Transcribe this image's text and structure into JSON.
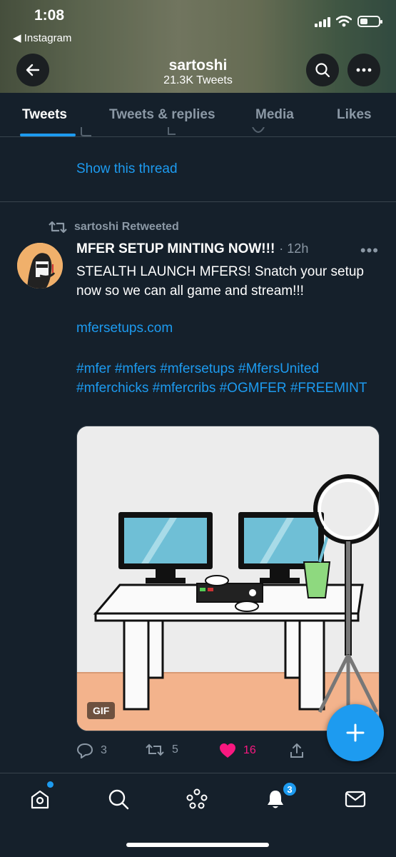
{
  "status": {
    "time": "1:08",
    "back_app": "◀ Instagram"
  },
  "header": {
    "name": "sartoshi",
    "tweet_count": "21.3K Tweets"
  },
  "tabs": [
    {
      "label": "Tweets",
      "active": true
    },
    {
      "label": "Tweets & replies"
    },
    {
      "label": "Media"
    },
    {
      "label": "Likes"
    }
  ],
  "previous_tweet": {
    "show_thread": "Show this thread"
  },
  "tweet": {
    "retweet_label": "sartoshi Retweeted",
    "display_name": "MFER SETUP MINTING NOW!!!",
    "time": "· 12h",
    "more": "•••",
    "text": "STEALTH LAUNCH MFERS! Snatch your setup now so we can all game and stream!!!",
    "link": "mfersetups.com",
    "hashtags": "#mfer #mfers #mfersetups #MfersUnited #mferchicks #mfercribs #OGMFER #FREEMINT",
    "media_badge": "GIF",
    "replies": "3",
    "retweets": "5",
    "likes": "16"
  },
  "bottom_nav": {
    "notification_count": "3"
  },
  "colors": {
    "accent": "#1d9bf0",
    "background": "#15202b",
    "like": "#f91880",
    "muted": "#8b98a5"
  }
}
